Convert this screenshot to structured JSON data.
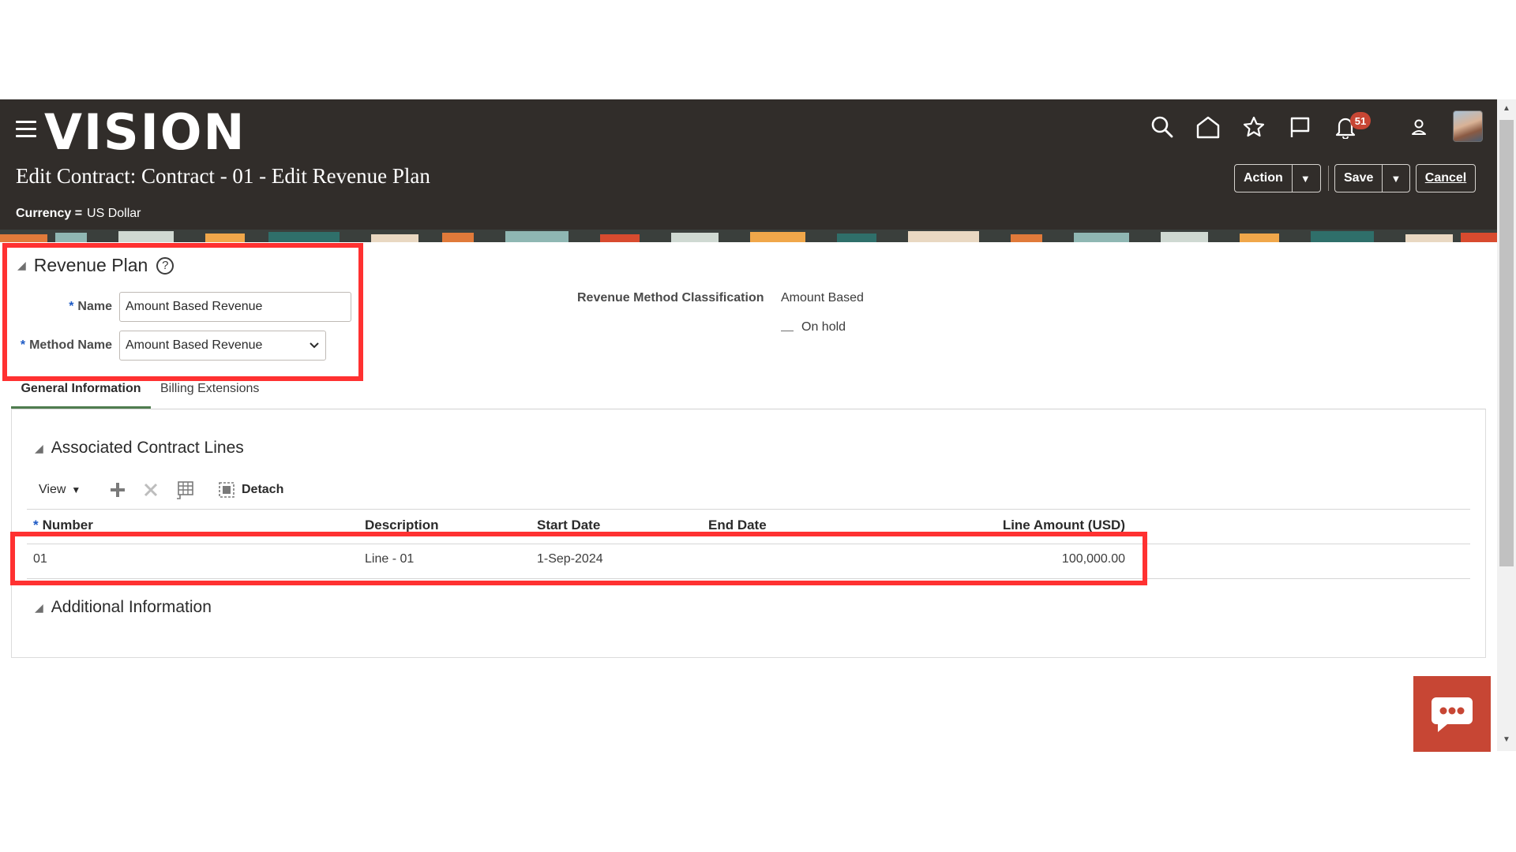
{
  "header": {
    "logo": "VISION",
    "notification_count": "51",
    "page_title": "Edit Contract: Contract - 01 - Edit Revenue Plan",
    "currency_label": "Currency =",
    "currency_value": "US Dollar",
    "buttons": {
      "action": "Action",
      "save": "Save",
      "cancel": "Cancel"
    },
    "icons": [
      "hamburger-menu-icon",
      "search-icon",
      "home-icon",
      "favorites-star-icon",
      "flag-icon",
      "notifications-bell-icon",
      "user-icon",
      "avatar"
    ]
  },
  "revenue_plan": {
    "title": "Revenue Plan",
    "name_label": "Name",
    "name_value": "Amount Based Revenue",
    "method_label": "Method Name",
    "method_value": "Amount Based Revenue",
    "classification_label": "Revenue Method Classification",
    "classification_value": "Amount Based",
    "hold_text": "On hold"
  },
  "tabs": [
    {
      "label": "General Information",
      "active": true
    },
    {
      "label": "Billing Extensions",
      "active": false
    }
  ],
  "contract_lines": {
    "title": "Associated Contract Lines",
    "toolbar": {
      "view": "View",
      "detach": "Detach"
    },
    "columns": [
      "Number",
      "Description",
      "Start Date",
      "End Date",
      "Line Amount (USD)"
    ],
    "rows": [
      {
        "number": "01",
        "description": "Line - 01",
        "start_date": "1-Sep-2024",
        "end_date": "",
        "amount": "100,000.00"
      }
    ]
  },
  "additional": {
    "title": "Additional Information"
  },
  "colors": {
    "header_bg": "#312d2a",
    "highlight": "#ff3131",
    "accent_red": "#c74634",
    "tab_underline": "#4f7d4f"
  }
}
